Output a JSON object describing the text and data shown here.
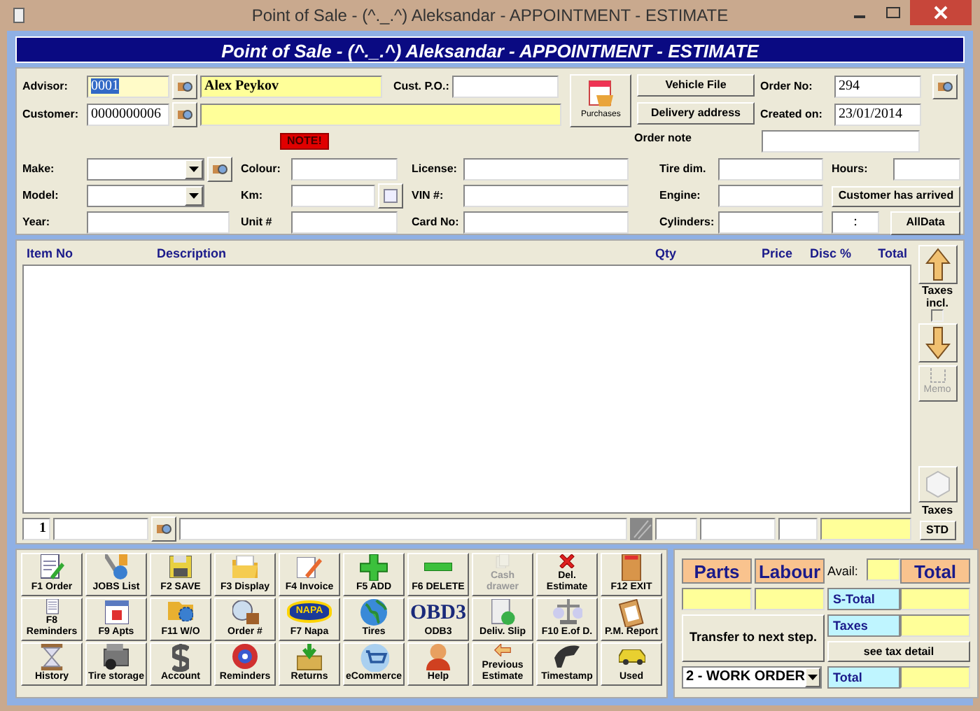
{
  "window": {
    "title": "Point of Sale - (^._.^) Aleksandar - APPOINTMENT - ESTIMATE"
  },
  "header": {
    "title": "Point of Sale - (^._.^) Aleksandar - APPOINTMENT - ESTIMATE"
  },
  "advisor": {
    "label": "Advisor:",
    "code": "0001",
    "name": "Alex Peykov"
  },
  "customer": {
    "label": "Customer:",
    "code": "0000000006"
  },
  "note_badge": "NOTE!",
  "cust_po": {
    "label": "Cust. P.O.:"
  },
  "purchases_button": "Purchases",
  "vehicle_file_button": "Vehicle File",
  "delivery_address_button": "Delivery address",
  "order_no": {
    "label": "Order No:",
    "value": "294"
  },
  "created_on": {
    "label": "Created on:",
    "value": "23/01/2014"
  },
  "order_note": {
    "label": "Order note"
  },
  "vehicle": [
    [
      {
        "label": "Make:",
        "kind": "dropdown-lookup"
      },
      {
        "label": "Model:",
        "kind": "dropdown"
      },
      {
        "label": "Year:",
        "kind": "text"
      }
    ],
    [
      {
        "label": "Colour:",
        "kind": "text"
      },
      {
        "label": "Km:",
        "kind": "calendar"
      },
      {
        "label": "Unit #",
        "kind": "text"
      }
    ],
    [
      {
        "label": "License:",
        "kind": "text"
      },
      {
        "label": "VIN #:",
        "kind": "text"
      },
      {
        "label": "Card No:",
        "kind": "text"
      }
    ],
    [
      {
        "label": "Tire dim.",
        "kind": "text"
      },
      {
        "label": "Engine:",
        "kind": "text"
      },
      {
        "label": "Cylinders:",
        "kind": "text"
      }
    ],
    [
      {
        "label": "Hours:",
        "kind": "text"
      },
      {
        "label": "Customer has arrived",
        "kind": "button"
      },
      {
        "kind": "time-button",
        "time_field": ":",
        "button": "AllData"
      }
    ]
  ],
  "items": {
    "columns": [
      "Item No",
      "Description",
      "Qty",
      "Price",
      "Disc %",
      "Total"
    ],
    "line_number": "1"
  },
  "side": {
    "taxes_incl_label": "Taxes incl.",
    "taxes_incl_checked": false,
    "memo_button": "Memo",
    "memo_disabled": true,
    "taxes_label": "Taxes",
    "std_button": "STD"
  },
  "function_buttons": [
    {
      "label": "F1 Order",
      "disabled": false
    },
    {
      "label": "JOBS List",
      "disabled": false
    },
    {
      "label": "F2 SAVE",
      "disabled": false
    },
    {
      "label": "F3 Display",
      "disabled": false
    },
    {
      "label": "F4 Invoice",
      "disabled": false
    },
    {
      "label": "F5 ADD",
      "disabled": false
    },
    {
      "label": "F6 DELETE",
      "disabled": false
    },
    {
      "label": "Cash drawer",
      "disabled": true
    },
    {
      "label": "Del. Estimate",
      "disabled": false
    },
    {
      "label": "F12 EXIT",
      "disabled": false
    },
    {
      "label": "F8 Reminders",
      "disabled": false
    },
    {
      "label": "F9 Apts",
      "disabled": false
    },
    {
      "label": "F11 W/O",
      "disabled": false
    },
    {
      "label": "Order #",
      "disabled": false
    },
    {
      "label": "F7 Napa",
      "disabled": false,
      "logo": "NAPA"
    },
    {
      "label": "Tires",
      "disabled": false
    },
    {
      "label": "ODB3",
      "disabled": false,
      "logo": "OBD3"
    },
    {
      "label": "Deliv. Slip",
      "disabled": false
    },
    {
      "label": "F10 E.of D.",
      "disabled": false
    },
    {
      "label": "P.M. Report",
      "disabled": false
    },
    {
      "label": "History",
      "disabled": false
    },
    {
      "label": "Tire storage",
      "disabled": false
    },
    {
      "label": "Account",
      "disabled": false
    },
    {
      "label": "Reminders",
      "disabled": false
    },
    {
      "label": "Returns",
      "disabled": false
    },
    {
      "label": "eCommerce",
      "disabled": false
    },
    {
      "label": "Help",
      "disabled": false
    },
    {
      "label": "Previous Estimate",
      "disabled": false
    },
    {
      "label": "Timestamp",
      "disabled": false
    },
    {
      "label": "Used",
      "disabled": false
    }
  ],
  "totals": {
    "parts": "Parts",
    "labour": "Labour",
    "avail": "Avail:",
    "total_header": "Total",
    "subtotal": "S-Total",
    "taxes": "Taxes",
    "total": "Total",
    "tax_detail_button": "see tax detail",
    "transfer_button": "Transfer to next step.",
    "step": "2 - WORK ORDER"
  }
}
